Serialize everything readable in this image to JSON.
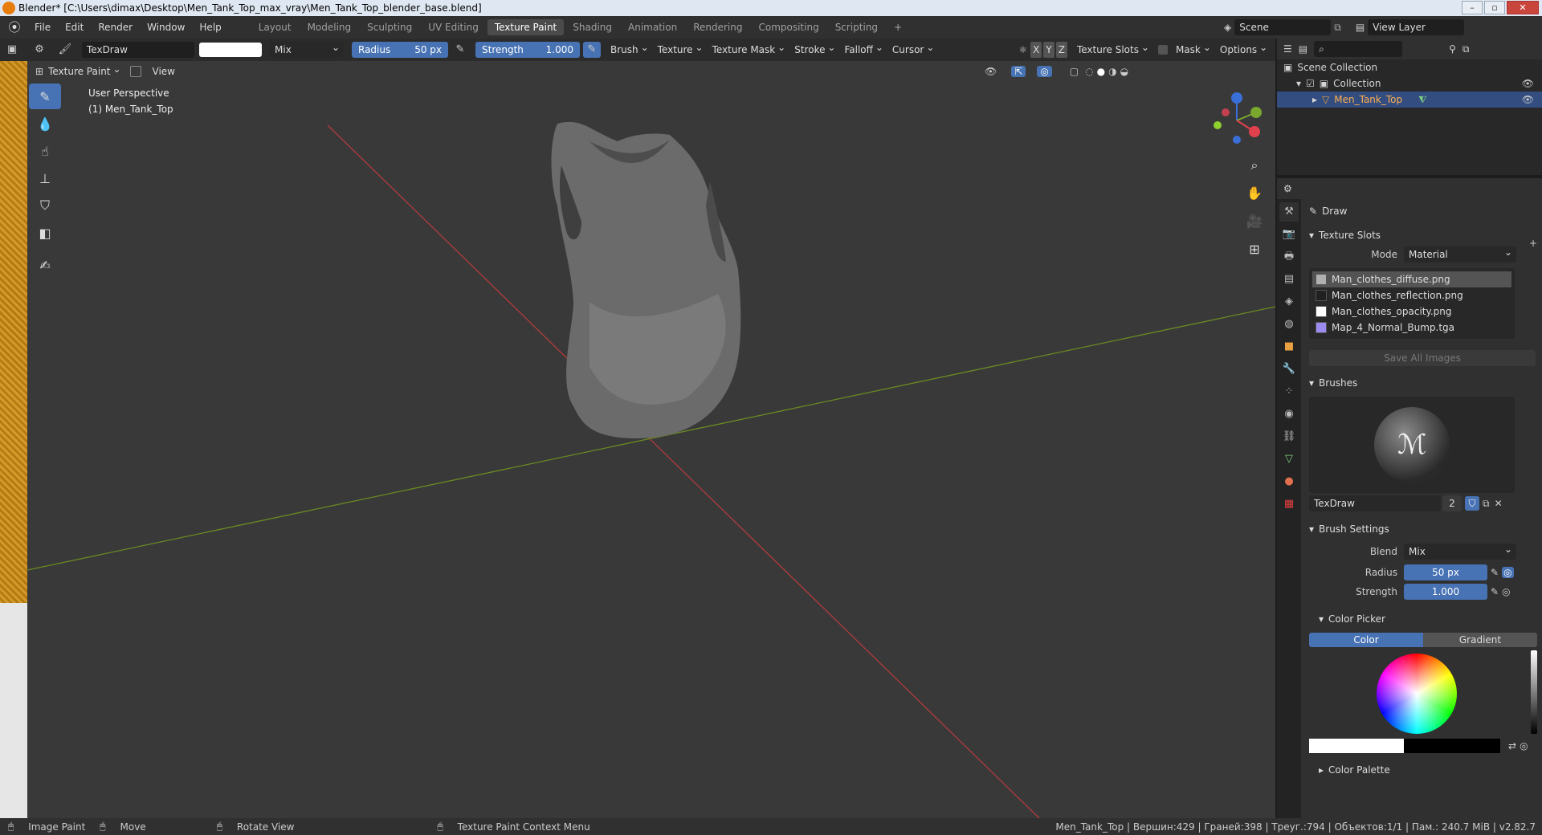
{
  "window": {
    "title": "Blender* [C:\\Users\\dimax\\Desktop\\Men_Tank_Top_max_vray\\Men_Tank_Top_blender_base.blend]"
  },
  "menu": [
    "File",
    "Edit",
    "Render",
    "Window",
    "Help"
  ],
  "workspaces": [
    {
      "label": "Layout"
    },
    {
      "label": "Modeling"
    },
    {
      "label": "Sculpting"
    },
    {
      "label": "UV Editing"
    },
    {
      "label": "Texture Paint",
      "active": true
    },
    {
      "label": "Shading"
    },
    {
      "label": "Animation"
    },
    {
      "label": "Rendering"
    },
    {
      "label": "Compositing"
    },
    {
      "label": "Scripting"
    }
  ],
  "scene": {
    "name": "Scene",
    "view_layer": "View Layer"
  },
  "tool_header": {
    "brush_name": "TexDraw",
    "blend": "Mix",
    "radius_label": "Radius",
    "radius_value": "50 px",
    "strength_label": "Strength",
    "strength_value": "1.000",
    "menus": [
      "Brush",
      "Texture",
      "Texture Mask",
      "Stroke",
      "Falloff",
      "Cursor"
    ],
    "axes": [
      "X",
      "Y",
      "Z"
    ],
    "texture_slots": "Texture Slots",
    "mask": "Mask",
    "options": "Options"
  },
  "viewport_header": {
    "mode": "Texture Paint",
    "view": "View"
  },
  "viewport": {
    "perspective": "User Perspective",
    "object": "(1) Men_Tank_Top"
  },
  "outliner": {
    "root": "Scene Collection",
    "collection": "Collection",
    "object": "Men_Tank_Top"
  },
  "properties": {
    "tool_name": "Draw",
    "texture_slots_title": "Texture Slots",
    "mode_label": "Mode",
    "mode_value": "Material",
    "slots": [
      {
        "name": "Man_clothes_diffuse.png",
        "color": "#b0b0b0",
        "selected": true
      },
      {
        "name": "Man_clothes_reflection.png",
        "color": "#202020"
      },
      {
        "name": "Man_clothes_opacity.png",
        "color": "#ffffff"
      },
      {
        "name": "Map_4_Normal_Bump.tga",
        "color": "#9a8cf0"
      }
    ],
    "save_all": "Save All Images",
    "brushes_title": "Brushes",
    "brush_name": "TexDraw",
    "brush_users": "2",
    "brush_settings_title": "Brush Settings",
    "blend_label": "Blend",
    "blend_value": "Mix",
    "radius_label": "Radius",
    "radius_value": "50 px",
    "strength_label": "Strength",
    "strength_value": "1.000",
    "color_picker_title": "Color Picker",
    "color_tab": "Color",
    "gradient_tab": "Gradient",
    "color_palette_title": "Color Palette"
  },
  "statusbar": {
    "image_paint": "Image Paint",
    "move": "Move",
    "rotate": "Rotate View",
    "context": "Texture Paint Context Menu",
    "stats": "Men_Tank_Top | Вершин:429 | Граней:398 | Треуг.:794 | Объектов:1/1 | Пам.: 240.7 MiB | v2.82.7"
  }
}
